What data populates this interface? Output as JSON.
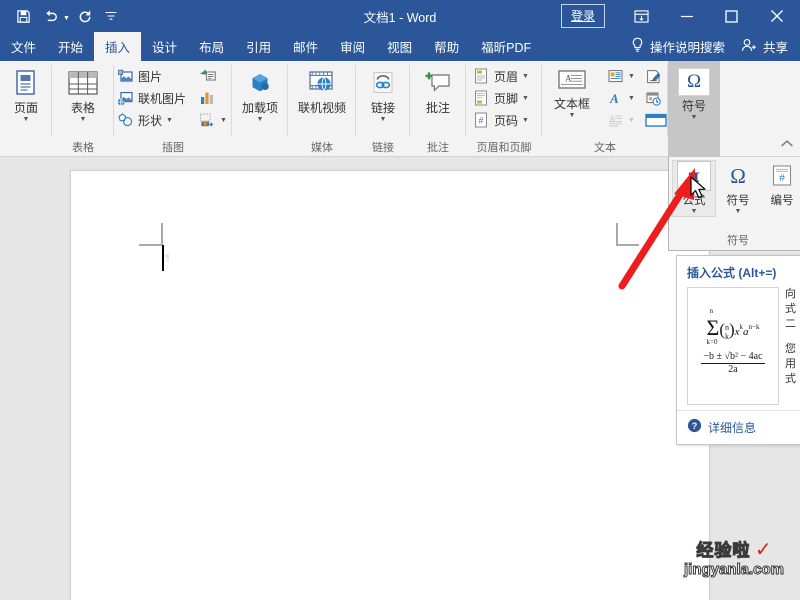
{
  "window": {
    "document_title": "文档1",
    "app_name": "Word",
    "title_separator": "-",
    "signin_label": "登录",
    "ribbon_display_icon": "ribbon-display-options-icon",
    "minimize_icon": "minimize-icon",
    "maximize_icon": "maximize-icon",
    "close_icon": "close-icon"
  },
  "quick_access": {
    "save_icon": "save-icon",
    "undo_icon": "undo-icon",
    "redo_icon": "redo-icon",
    "customize_icon": "customize-quick-access-icon"
  },
  "tabs": [
    {
      "label": "文件",
      "active": false
    },
    {
      "label": "开始",
      "active": false
    },
    {
      "label": "插入",
      "active": true
    },
    {
      "label": "设计",
      "active": false
    },
    {
      "label": "布局",
      "active": false
    },
    {
      "label": "引用",
      "active": false
    },
    {
      "label": "邮件",
      "active": false
    },
    {
      "label": "审阅",
      "active": false
    },
    {
      "label": "视图",
      "active": false
    },
    {
      "label": "帮助",
      "active": false
    },
    {
      "label": "福昕PDF",
      "active": false
    }
  ],
  "tab_right": {
    "tellme_label": "操作说明搜索",
    "tellme_icon": "lightbulb-icon",
    "share_label": "共享",
    "share_icon": "share-person-icon"
  },
  "ribbon": {
    "groups": [
      {
        "name": "pages",
        "label": "",
        "items": [
          {
            "label": "页面",
            "icon": "pages-icon",
            "dropdown": true
          }
        ]
      },
      {
        "name": "tables",
        "label": "表格",
        "items": [
          {
            "label": "表格",
            "icon": "table-icon",
            "dropdown": true
          }
        ]
      },
      {
        "name": "illustrations",
        "label": "插图",
        "items": [
          {
            "label": "图片",
            "icon": "picture-icon",
            "dropdown": false
          },
          {
            "label": "联机图片",
            "icon": "online-picture-icon",
            "dropdown": false
          },
          {
            "label": "形状",
            "icon": "shapes-icon",
            "dropdown": true
          },
          {
            "label": "",
            "icon": "smartart-icon",
            "dropdown": false
          },
          {
            "label": "",
            "icon": "chart-icon",
            "dropdown": false
          },
          {
            "label": "",
            "icon": "screenshot-icon",
            "dropdown": true
          }
        ]
      },
      {
        "name": "media",
        "label": "媒体",
        "items": [
          {
            "label": "加载项",
            "icon": "addins-icon",
            "dropdown": true
          }
        ]
      },
      {
        "name": "media2",
        "label": "媒体",
        "items": [
          {
            "label": "联机视频",
            "icon": "online-video-icon",
            "dropdown": false
          }
        ]
      },
      {
        "name": "links",
        "label": "链接",
        "items": [
          {
            "label": "链接",
            "icon": "link-icon",
            "dropdown": true
          }
        ]
      },
      {
        "name": "comments",
        "label": "批注",
        "items": [
          {
            "label": "批注",
            "icon": "comment-icon",
            "dropdown": false
          }
        ]
      },
      {
        "name": "header_footer",
        "label": "页眉和页脚",
        "items": [
          {
            "label": "页眉",
            "icon": "header-icon",
            "dropdown": true
          },
          {
            "label": "页脚",
            "icon": "footer-icon",
            "dropdown": true
          },
          {
            "label": "页码",
            "icon": "page-number-icon",
            "dropdown": true
          }
        ]
      },
      {
        "name": "text",
        "label": "文本",
        "items": [
          {
            "label": "文本框",
            "icon": "textbox-icon",
            "dropdown": true
          },
          {
            "label": "",
            "icon": "quick-parts-icon",
            "dropdown": true
          },
          {
            "label": "",
            "icon": "wordart-icon",
            "dropdown": true
          },
          {
            "label": "",
            "icon": "dropcap-icon",
            "dropdown": true
          },
          {
            "label": "",
            "icon": "signature-line-icon",
            "dropdown": true
          },
          {
            "label": "",
            "icon": "date-time-icon",
            "dropdown": false
          },
          {
            "label": "",
            "icon": "object-icon",
            "dropdown": true
          }
        ]
      },
      {
        "name": "symbols",
        "label": "符号",
        "items": [
          {
            "label": "符号",
            "icon": "omega-icon",
            "dropdown": true,
            "pressed": true
          }
        ]
      }
    ],
    "collapse_icon": "collapse-ribbon-icon"
  },
  "symbol_dropdown": {
    "group_label": "符号",
    "items": [
      {
        "label": "公式",
        "icon": "equation-pi-icon",
        "dropdown": true,
        "selected": true
      },
      {
        "label": "符号",
        "icon": "omega-icon",
        "dropdown": true,
        "selected": false
      },
      {
        "label": "编号",
        "icon": "number-hash-icon",
        "dropdown": false,
        "selected": false
      }
    ]
  },
  "tooltip": {
    "title": "插入公式 (Alt+=)",
    "preview": {
      "summation": "Σ",
      "sum_upper": "n",
      "sum_lower": "k=0",
      "binomial_top": "n",
      "binomial_bottom": "k",
      "sum_tail": "x",
      "sum_tail_sup": "k",
      "sum_tail2": "a",
      "sum_tail2_sup": "n−k",
      "fraction_numerator": "−b ± √b² − 4ac",
      "fraction_denominator": "2a"
    },
    "side_lines": [
      "向",
      "式",
      "二",
      "您",
      "用",
      "式"
    ],
    "footer_label": "详细信息",
    "footer_icon": "help-question-icon"
  },
  "document": {
    "caret_visible": true,
    "margin_marks": "corner-margin-marks"
  },
  "annotation": {
    "arrow_icon": "red-arrow-annotation",
    "arrow_color": "#ee1c1c",
    "cursor_icon": "mouse-pointer-icon"
  },
  "watermark": {
    "line1": "经验啦",
    "check": "✓",
    "line2": "jingyanla.com"
  },
  "colors": {
    "titlebar": "#2b579a",
    "ribbon": "#f3f3f3",
    "accent": "#2b579a",
    "doc_background": "#e6e6e6",
    "arrow_red": "#ee1c1c"
  }
}
